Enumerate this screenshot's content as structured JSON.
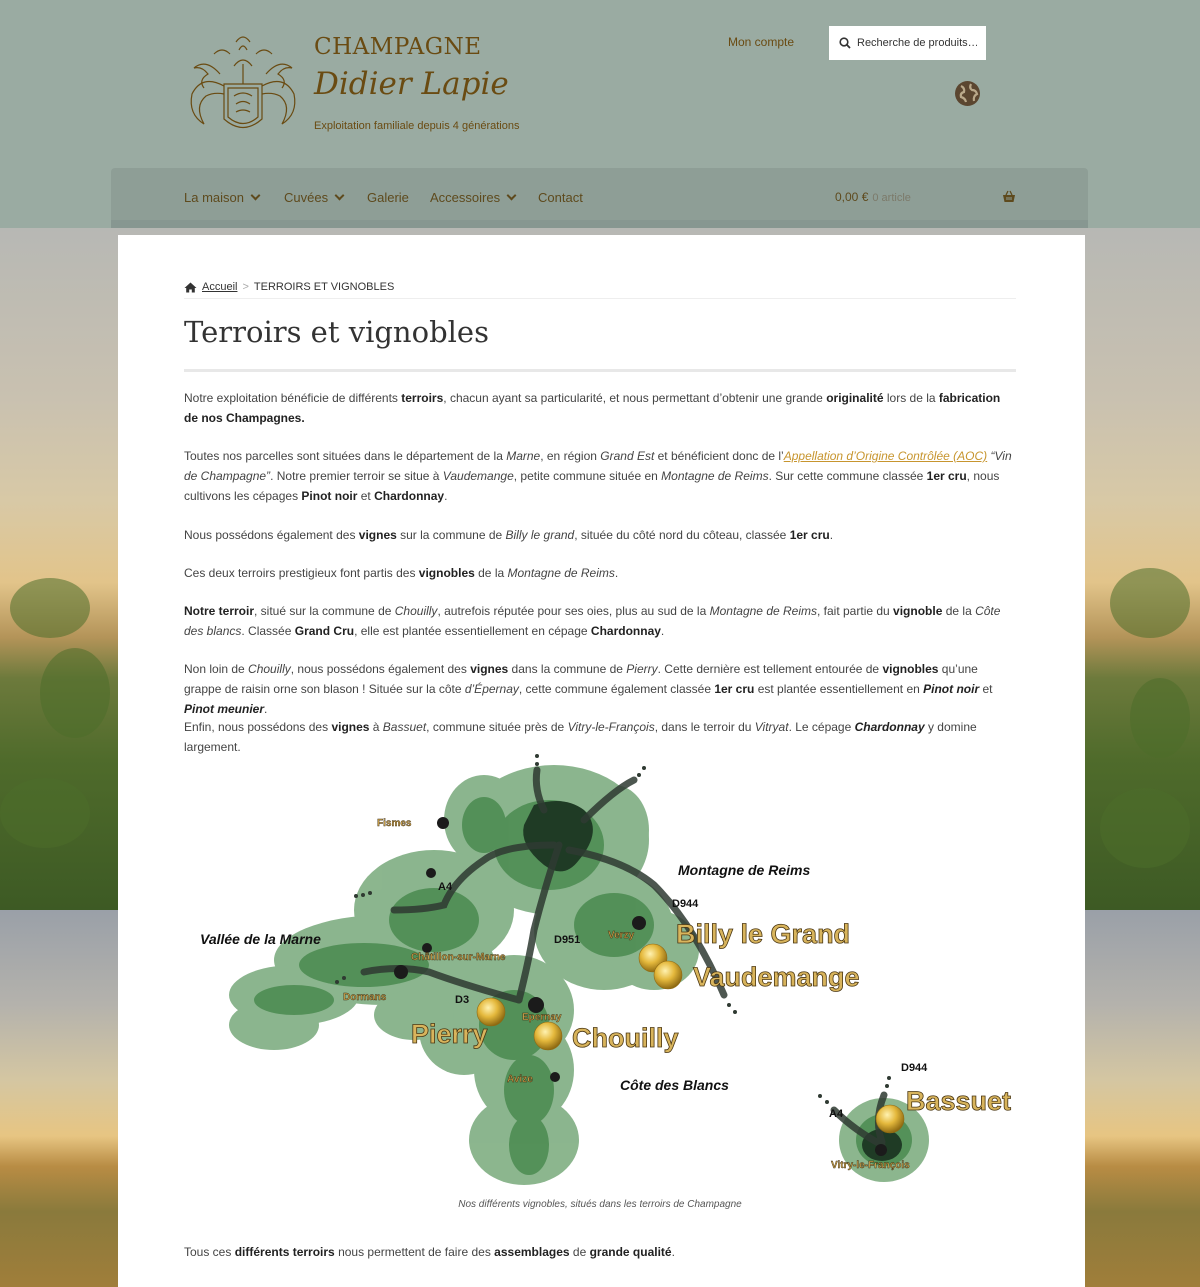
{
  "header": {
    "brand_line1": "CHAMPAGNE",
    "brand_line2": "Didier Lapie",
    "tagline": "Exploitation familiale depuis 4 générations",
    "account_link": "Mon compte",
    "search_placeholder": "Recherche de produits…"
  },
  "nav": {
    "items": [
      {
        "label": "La maison",
        "has_dropdown": true
      },
      {
        "label": "Cuvées",
        "has_dropdown": true
      },
      {
        "label": "Galerie",
        "has_dropdown": false
      },
      {
        "label": "Accessoires",
        "has_dropdown": true
      },
      {
        "label": "Contact",
        "has_dropdown": false
      }
    ],
    "cart_total": "0,00 €",
    "cart_count": "0 article"
  },
  "breadcrumb": {
    "home": "Accueil",
    "separator": ">",
    "current": "TERROIRS ET VIGNOBLES"
  },
  "page_title": "Terroirs et vignobles",
  "map": {
    "regions": [
      "Montagne de Reims",
      "Vallée de la Marne",
      "Côte des Blancs"
    ],
    "towns": [
      "Fismes",
      "Verzy",
      "Châtillon-sur-Marne",
      "Dormans",
      "Epernay",
      "Avize",
      "Vitry-le-François"
    ],
    "roads": [
      "A4",
      "D944",
      "D951",
      "D3",
      "A4",
      "D944"
    ],
    "vineyards": [
      "Billy le Grand",
      "Vaudemange",
      "Pierry",
      "Chouilly",
      "Bassuet"
    ],
    "caption": "Nos différents vignobles, situés dans les terroirs de Champagne"
  },
  "closing": {
    "t1": "Tous ces ",
    "b1": "différents terroirs",
    "t2": " nous permettent de faire des ",
    "b2": "assemblages",
    "t3": " de ",
    "b3": "grande qualité",
    "t4": "."
  },
  "colors": {
    "header_bg": "#9aaba2",
    "nav_bg": "#8e9e96",
    "brand_brown": "#6a4b12",
    "link_gold": "#c7952e",
    "map_green": "#4f8a52",
    "vineyard_gold": "#e0b13a"
  }
}
